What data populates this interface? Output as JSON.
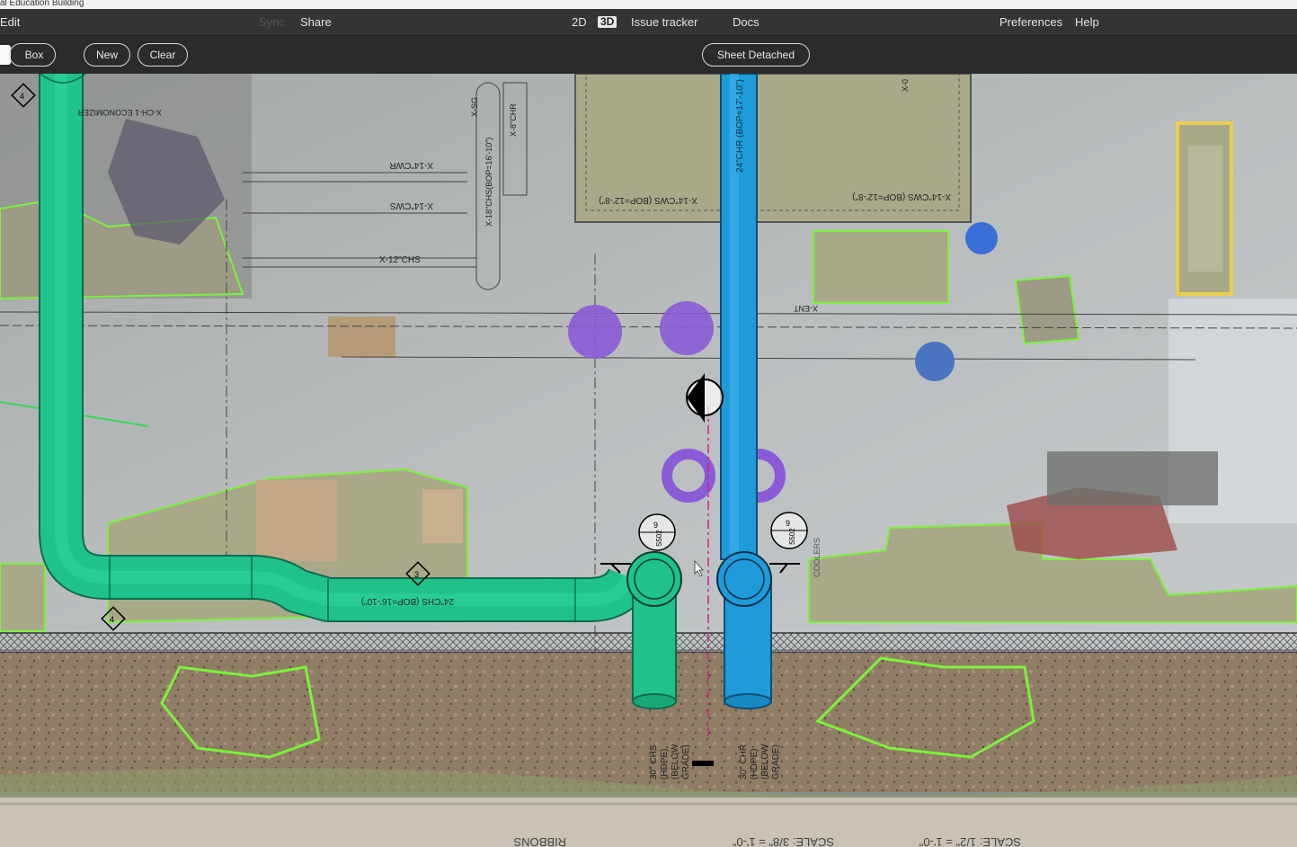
{
  "window": {
    "title": "al Education Building"
  },
  "menu": {
    "edit": "Edit",
    "sync": "Sync",
    "share": "Share",
    "mode_2d": "2D",
    "mode_3d": "3D",
    "issue_tracker": "Issue tracker",
    "docs": "Docs",
    "preferences": "Preferences",
    "help": "Help"
  },
  "toolbar": {
    "box": "Box",
    "new": "New",
    "clear": "Clear",
    "sheet_detached": "Sheet Detached"
  },
  "drawing": {
    "labels": {
      "chs_green": "24\"CHS (BOP=16'-10\")",
      "chr_blue": "24\"CHR (BOP=17'-10\")",
      "chs_right_1": "X-18\"CHS(BOP=16'-10\")",
      "chs_right_2": "X-8\"CHR",
      "cwr": "X-14\"CWR",
      "cws": "X-14\"CWS",
      "chs12": "X-12\"CHS",
      "econ": "X-CH-1 ECONOMIZER",
      "cws_bop_left": "X-14\"CWS (BOP=12'-8\")",
      "cws_bop_right": "X-14\"CWS (BOP=12'-8\")",
      "xgs": "X-SG",
      "xent": "X-ENT",
      "x_top": "X-0",
      "below_chs_1": "30\" CHS",
      "below_chs_2": "(HDPE)",
      "below_chs_3": "(BELOW",
      "below_chs_4": "GRADE)",
      "below_chr_1": "30\" CHR",
      "below_chr_2": "(HDPE)",
      "below_chr_3": "(BELOW",
      "below_chr_4": "GRADE)",
      "tag_num": "9",
      "tag_sheet": "S502",
      "diamond_left": "4",
      "diamond_mid": "3",
      "diamond_top": "4",
      "coolers": "COOLERS",
      "scale_1": "SCALE: 3/8\" = 1'-0\"",
      "scale_2": "SCALE: 1/2\" = 1'-0\"",
      "bottom_ribbon": "RIBBONS"
    }
  },
  "colors": {
    "chs_pipe": "#1fc28b",
    "chr_pipe": "#1e9bd8",
    "menubar_bg": "#333435",
    "toolbar_bg": "#2b2b2c",
    "outline_green": "#7cf23a",
    "purple": "#8a5bd6"
  }
}
